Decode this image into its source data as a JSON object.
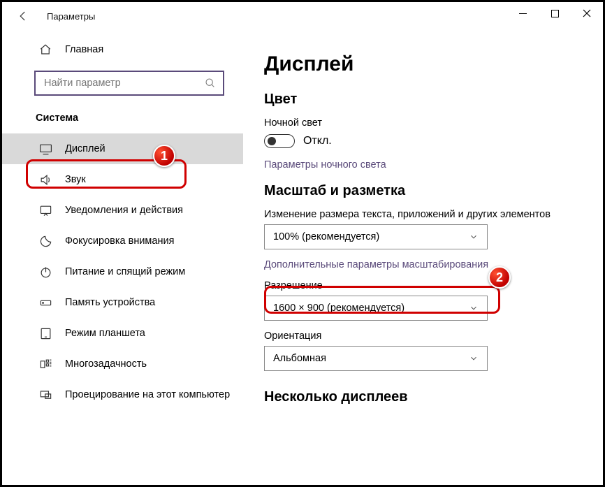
{
  "titlebar": {
    "title": "Параметры"
  },
  "sidebar": {
    "home": "Главная",
    "search_placeholder": "Найти параметр",
    "group": "Система",
    "items": [
      {
        "label": "Дисплей"
      },
      {
        "label": "Звук"
      },
      {
        "label": "Уведомления и действия"
      },
      {
        "label": "Фокусировка внимания"
      },
      {
        "label": "Питание и спящий режим"
      },
      {
        "label": "Память устройства"
      },
      {
        "label": "Режим планшета"
      },
      {
        "label": "Многозадачность"
      },
      {
        "label": "Проецирование на этот компьютер"
      }
    ]
  },
  "content": {
    "h1": "Дисплей",
    "color_h": "Цвет",
    "night_label": "Ночной свет",
    "toggle_state": "Откл.",
    "night_link": "Параметры ночного света",
    "scale_h": "Масштаб и разметка",
    "scale_label": "Изменение размера текста, приложений и других элементов",
    "scale_value": "100% (рекомендуется)",
    "adv_scale_link": "Дополнительные параметры масштабирования",
    "res_label": "Разрешение",
    "res_value": "1600 × 900 (рекомендуется)",
    "orient_label": "Ориентация",
    "orient_value": "Альбомная",
    "multi_h": "Несколько дисплеев"
  },
  "badges": {
    "one": "1",
    "two": "2"
  }
}
